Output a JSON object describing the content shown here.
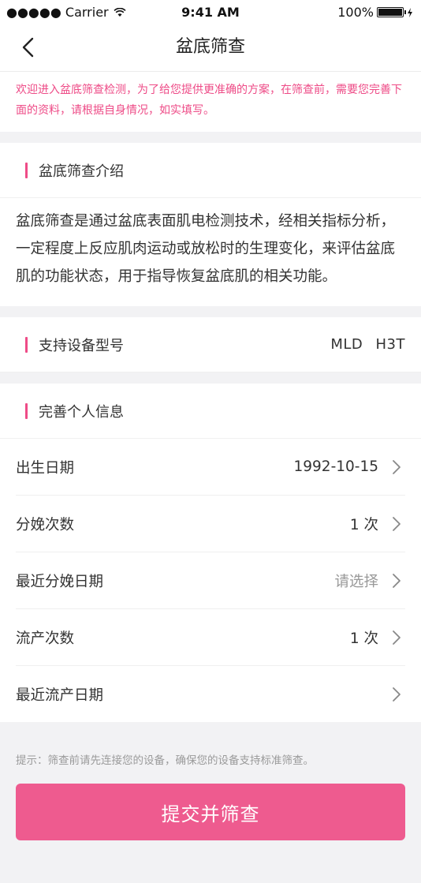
{
  "status_bar": {
    "carrier": "●●●●● Carrier",
    "time": "9:41 AM",
    "battery": "100%",
    "battery_level": 1.0
  },
  "nav": {
    "title": "盆底筛查",
    "back_icon": "chevron-left-icon"
  },
  "notice": "欢迎进入盆底筛查检测，为了给您提供更准确的方案，在筛查前，需要您完善下面的资料，请根据自身情况，如实填写。",
  "intro": {
    "heading": "盆底筛查介绍",
    "body": "盆底筛查是通过盆底表面肌电检测技术，经相关指标分析，一定程度上反应肌肉运动或放松时的生理变化，来评估盆底肌的功能状态，用于指导恢复盆底肌的相关功能。"
  },
  "device": {
    "heading": "支持设备型号",
    "models": "MLD H3T"
  },
  "personal": {
    "heading": "完善个人信息",
    "rows": [
      {
        "label": "出生日期",
        "value": "1992-10-15"
      },
      {
        "label": "分娩次数",
        "value": "1 次"
      },
      {
        "label": "最近分娩日期",
        "value": "请选择"
      },
      {
        "label": "流产次数",
        "value": "1 次"
      },
      {
        "label": "最近流产日期",
        "value": ""
      }
    ]
  },
  "footer": {
    "tip": "提示：筛查前请先连接您的设备，确保您的设备支持标准筛查。",
    "submit_label": "提交并筛查"
  },
  "colors": {
    "accent": "#ee4b87",
    "button": "#ee5b8f",
    "background": "#f2f2f4"
  }
}
